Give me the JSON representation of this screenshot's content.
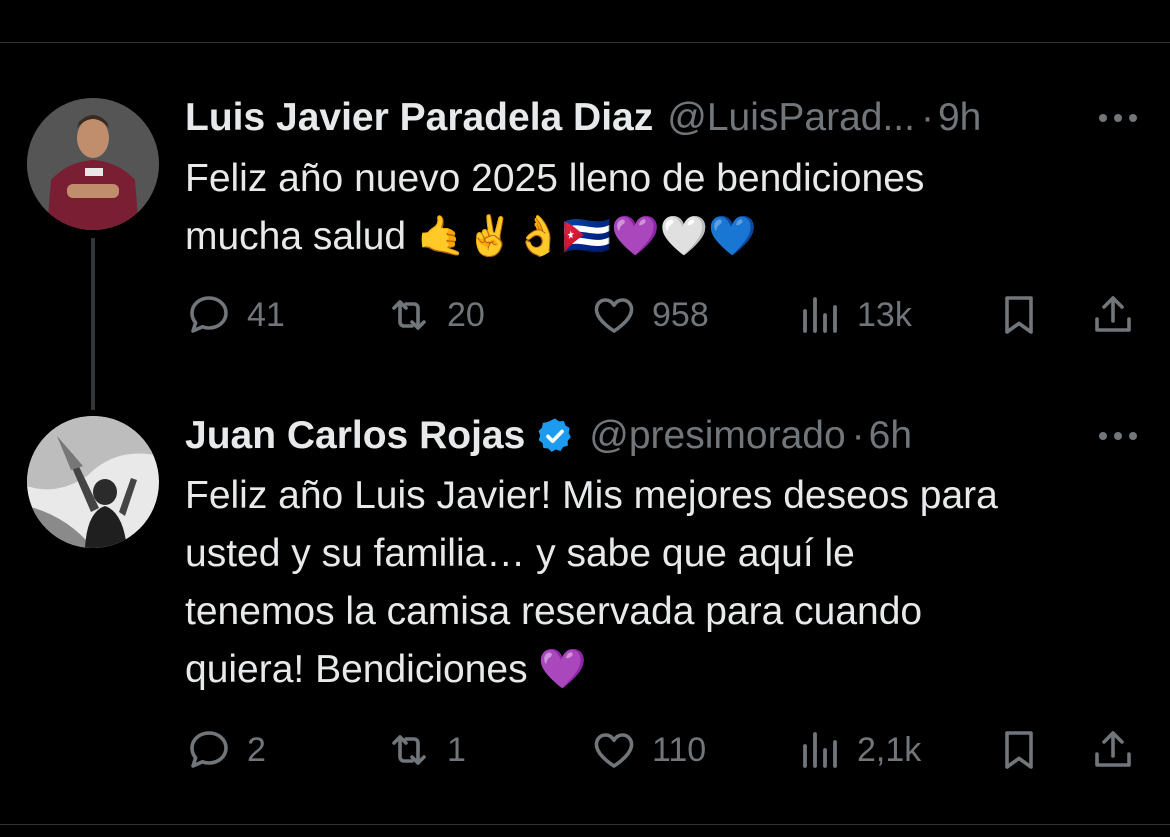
{
  "tweets": [
    {
      "display_name": "Luis Javier Paradela Diaz",
      "handle": "@LuisParad...",
      "separator": "·",
      "time": "9h",
      "verified": false,
      "text": "Feliz año nuevo 2025 lleno de bendiciones\nmucha salud 🤙✌️👌🇨🇺💜🤍💙",
      "stats": {
        "replies": "41",
        "retweets": "20",
        "likes": "958",
        "views": "13k"
      }
    },
    {
      "display_name": "Juan Carlos Rojas",
      "handle": "@presimorado",
      "separator": "·",
      "time": "6h",
      "verified": true,
      "text": "Feliz año Luis Javier! Mis mejores deseos para\nusted y su familia… y sabe que aquí le\ntenemos la camisa reservada para cuando\nquiera! Bendiciones 💜",
      "stats": {
        "replies": "2",
        "retweets": "1",
        "likes": "110",
        "views": "2,1k"
      }
    }
  ],
  "colors": {
    "background": "#000000",
    "text": "#e7e9ea",
    "secondary": "#71767b",
    "verified_badge": "#1d9bf0",
    "divider": "#2f3336"
  },
  "icons": [
    "reply-icon",
    "retweet-icon",
    "like-icon",
    "views-icon",
    "bookmark-icon",
    "share-icon",
    "more-icon",
    "verified-icon"
  ]
}
